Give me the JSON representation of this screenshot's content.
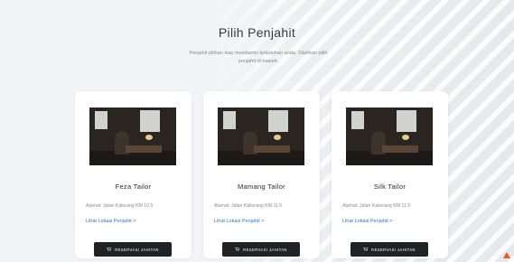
{
  "header": {
    "title": "Pilih Penjahit",
    "subtitle": "Penjahit pilihan siap membantu kebutuhan anda. Silahkan pilih penjahit di bawah."
  },
  "cards": [
    {
      "name": "Feza Tailor",
      "address": "Alamat: Jalan Kalurang KM 10.5",
      "link_label": "Lihat Lokasi Penjahit >",
      "button_label": "RESERVASI JAHITAN"
    },
    {
      "name": "Mamang Tailor",
      "address": "Alamat: Jalan Kaliurang KM 11.5",
      "link_label": "Lihat Lokasi Penjahit >",
      "button_label": "RESERVASI JAHITAN"
    },
    {
      "name": "Silk Tailor",
      "address": "Alamat: Jalan Kaliurang KM 11.5",
      "link_label": "Lihat Lokasi Penjahit >",
      "button_label": "RESERVASI JAHITAN"
    }
  ],
  "icons": {
    "cart": "cart-icon",
    "scroll_top": "arrow-up-icon"
  },
  "colors": {
    "link": "#2f77c9",
    "button": "#1f2326",
    "scroll_top": "#e85a2a"
  }
}
